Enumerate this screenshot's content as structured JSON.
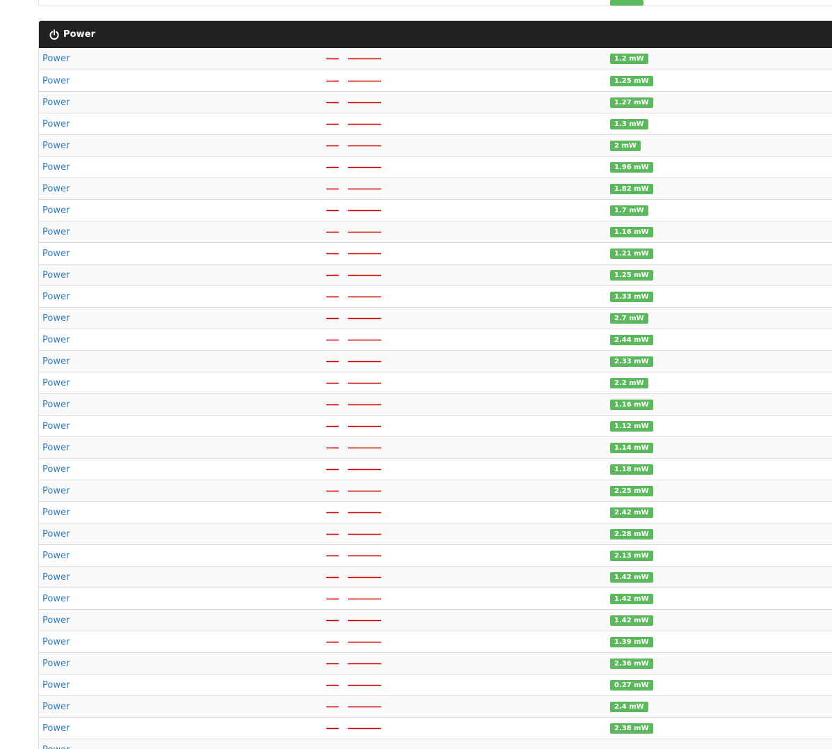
{
  "panel": {
    "title": "Power",
    "icon": "power-icon",
    "heading_color": "#222222"
  },
  "colors": {
    "link": "#337ab7",
    "badge_success": "#5cb85c",
    "sparkline": "#cc0000",
    "row_stripe": "#f9f9f9"
  },
  "rows": [
    {
      "label": "Power",
      "value": "1.2 mW"
    },
    {
      "label": "Power",
      "value": "1.25 mW"
    },
    {
      "label": "Power",
      "value": "1.27 mW"
    },
    {
      "label": "Power",
      "value": "1.3 mW"
    },
    {
      "label": "Power",
      "value": "2 mW"
    },
    {
      "label": "Power",
      "value": "1.96 mW"
    },
    {
      "label": "Power",
      "value": "1.82 mW"
    },
    {
      "label": "Power",
      "value": "1.7 mW"
    },
    {
      "label": "Power",
      "value": "1.16 mW"
    },
    {
      "label": "Power",
      "value": "1.21 mW"
    },
    {
      "label": "Power",
      "value": "1.25 mW"
    },
    {
      "label": "Power",
      "value": "1.33 mW"
    },
    {
      "label": "Power",
      "value": "2.7 mW"
    },
    {
      "label": "Power",
      "value": "2.44 mW"
    },
    {
      "label": "Power",
      "value": "2.33 mW"
    },
    {
      "label": "Power",
      "value": "2.2 mW"
    },
    {
      "label": "Power",
      "value": "1.16 mW"
    },
    {
      "label": "Power",
      "value": "1.12 mW"
    },
    {
      "label": "Power",
      "value": "1.14 mW"
    },
    {
      "label": "Power",
      "value": "1.18 mW"
    },
    {
      "label": "Power",
      "value": "2.25 mW"
    },
    {
      "label": "Power",
      "value": "2.42 mW"
    },
    {
      "label": "Power",
      "value": "2.28 mW"
    },
    {
      "label": "Power",
      "value": "2.13 mW"
    },
    {
      "label": "Power",
      "value": "1.42 mW"
    },
    {
      "label": "Power",
      "value": "1.42 mW"
    },
    {
      "label": "Power",
      "value": "1.42 mW"
    },
    {
      "label": "Power",
      "value": "1.39 mW"
    },
    {
      "label": "Power",
      "value": "2.36 mW"
    },
    {
      "label": "Power",
      "value": "0.27 mW"
    },
    {
      "label": "Power",
      "value": "2.4 mW"
    },
    {
      "label": "Power",
      "value": "2.38 mW"
    },
    {
      "label": "Power",
      "value": ""
    }
  ]
}
